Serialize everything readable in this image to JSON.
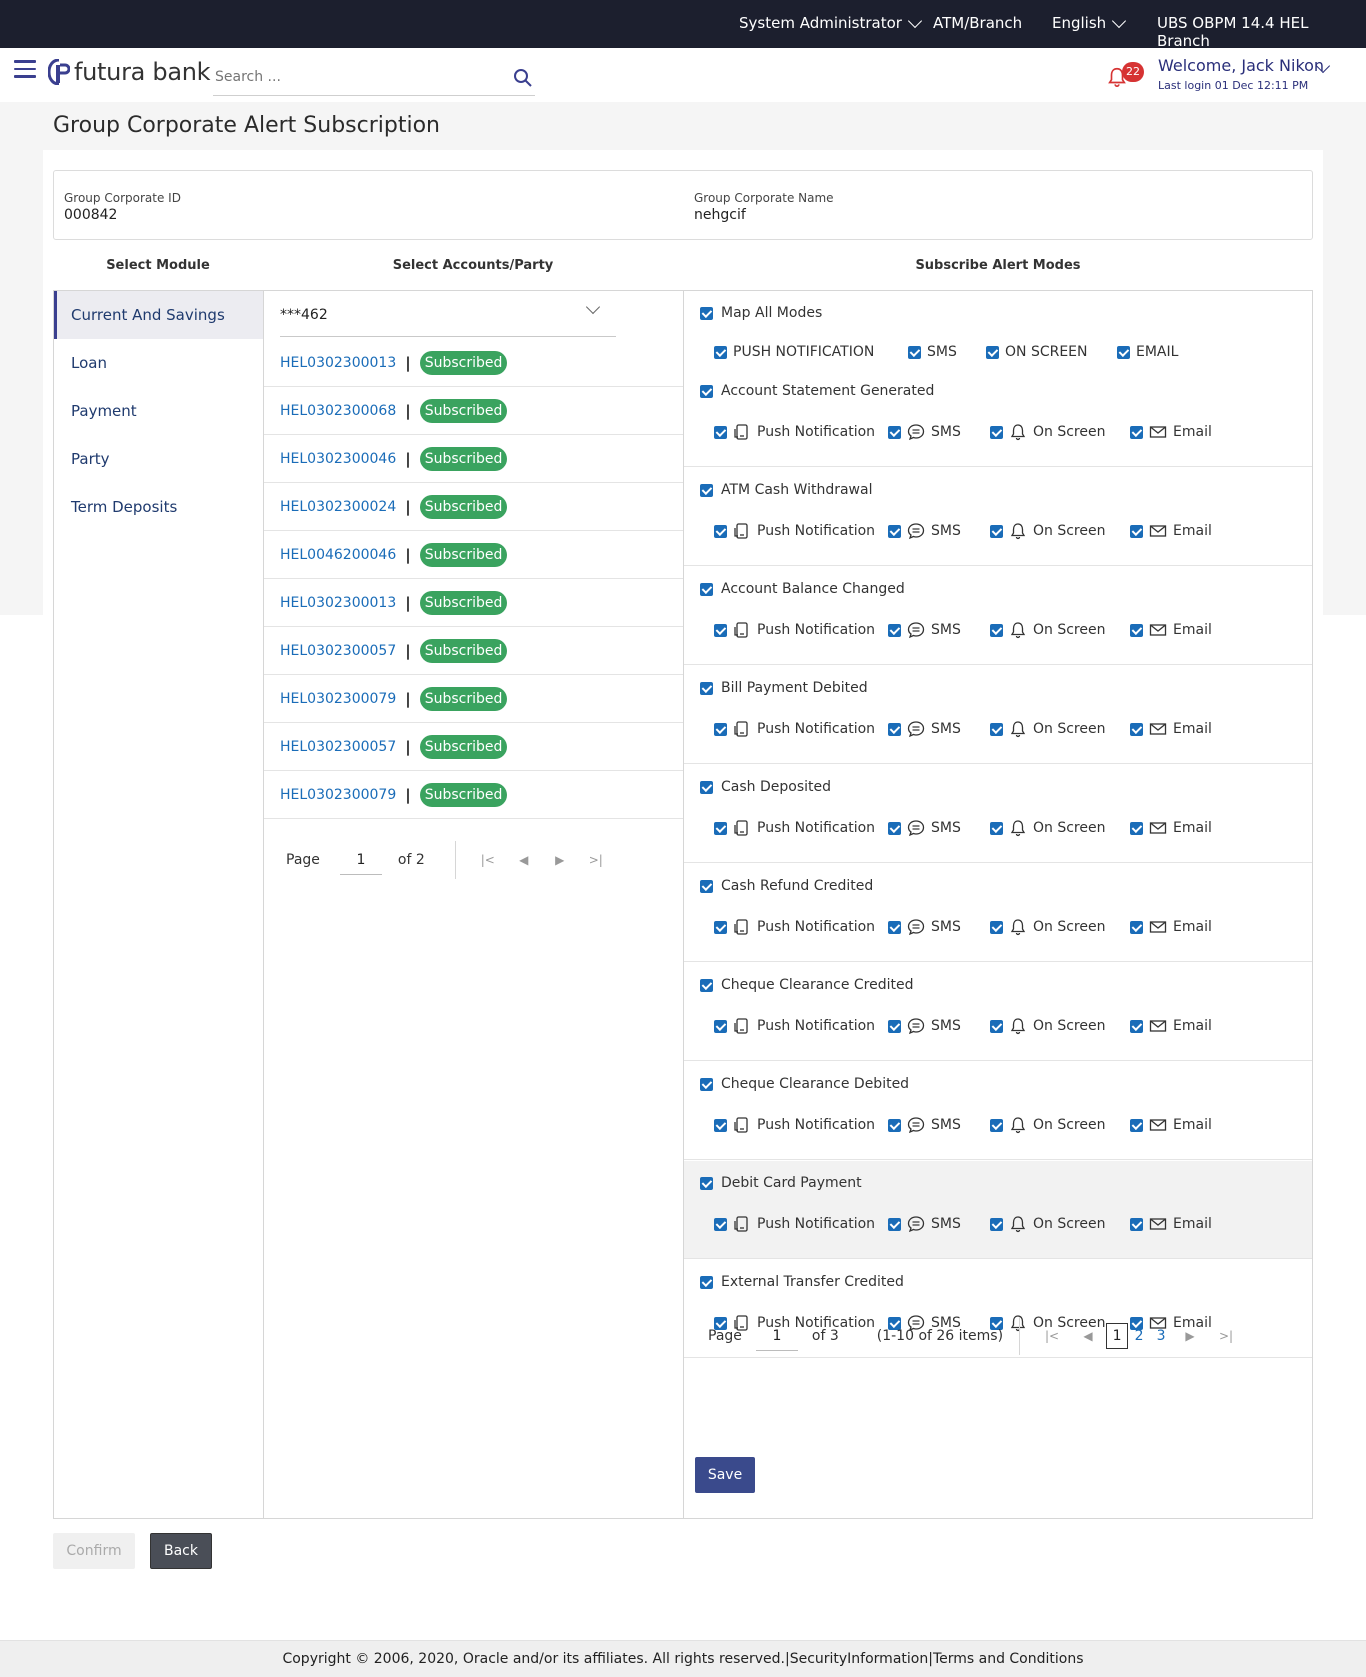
{
  "topbar": {
    "role": "System Administrator",
    "atm_branch": "ATM/Branch",
    "language": "English",
    "branch": "UBS OBPM 14.4 HEL Branch"
  },
  "header": {
    "logo_text": "futura bank",
    "search_placeholder": "Search ...",
    "notification_count": "22",
    "welcome": "Welcome, Jack Nikon",
    "last_login": "Last login 01 Dec 12:11 PM"
  },
  "page_title": "Group Corporate Alert Subscription",
  "corporate": {
    "id_label": "Group Corporate ID",
    "id_value": "000842",
    "name_label": "Group Corporate Name",
    "name_value": "nehgcif"
  },
  "columns": {
    "module": "Select Module",
    "accounts": "Select Accounts/Party",
    "modes": "Subscribe Alert Modes"
  },
  "modules": [
    {
      "label": "Current And Savings",
      "active": true
    },
    {
      "label": "Loan",
      "active": false
    },
    {
      "label": "Payment",
      "active": false
    },
    {
      "label": "Party",
      "active": false
    },
    {
      "label": "Term Deposits",
      "active": false
    }
  ],
  "account_select": {
    "value": "***462"
  },
  "accounts": [
    {
      "number": "HEL0302300013",
      "status": "Subscribed"
    },
    {
      "number": "HEL0302300068",
      "status": "Subscribed"
    },
    {
      "number": "HEL0302300046",
      "status": "Subscribed"
    },
    {
      "number": "HEL0302300024",
      "status": "Subscribed"
    },
    {
      "number": "HEL0046200046",
      "status": "Subscribed"
    },
    {
      "number": "HEL0302300013",
      "status": "Subscribed"
    },
    {
      "number": "HEL0302300057",
      "status": "Subscribed"
    },
    {
      "number": "HEL0302300079",
      "status": "Subscribed"
    },
    {
      "number": "HEL0302300057",
      "status": "Subscribed"
    },
    {
      "number": "HEL0302300079",
      "status": "Subscribed"
    }
  ],
  "accounts_pager": {
    "label": "Page",
    "page": "1",
    "of": "of 2"
  },
  "map_all": {
    "label": "Map All Modes",
    "modes": [
      "PUSH NOTIFICATION",
      "SMS",
      "ON SCREEN",
      "EMAIL"
    ]
  },
  "mode_labels": {
    "push": "Push Notification",
    "sms": "SMS",
    "screen": "On Screen",
    "email": "Email"
  },
  "alerts": [
    {
      "title": "Account Statement Generated"
    },
    {
      "title": "ATM Cash Withdrawal"
    },
    {
      "title": "Account Balance Changed"
    },
    {
      "title": "Bill Payment Debited"
    },
    {
      "title": "Cash Deposited"
    },
    {
      "title": "Cash Refund Credited"
    },
    {
      "title": "Cheque Clearance Credited"
    },
    {
      "title": "Cheque Clearance Debited"
    },
    {
      "title": "Debit Card Payment"
    },
    {
      "title": "External Transfer Credited"
    }
  ],
  "alerts_pager": {
    "label": "Page",
    "page": "1",
    "of": "of 3",
    "items": "(1-10 of 26 items)",
    "pages": [
      "1",
      "2",
      "3"
    ]
  },
  "buttons": {
    "save": "Save",
    "confirm": "Confirm",
    "back": "Back"
  },
  "footer": {
    "copyright": "Copyright © 2006, 2020, Oracle and/or its affiliates. All rights reserved.",
    "security": "SecurityInformation",
    "terms": "Terms and Conditions"
  },
  "colors": {
    "brand": "#3a3f8f",
    "link": "#1a6cb8",
    "subscribed": "#3aa35f",
    "topbar": "#1c1f2e"
  }
}
